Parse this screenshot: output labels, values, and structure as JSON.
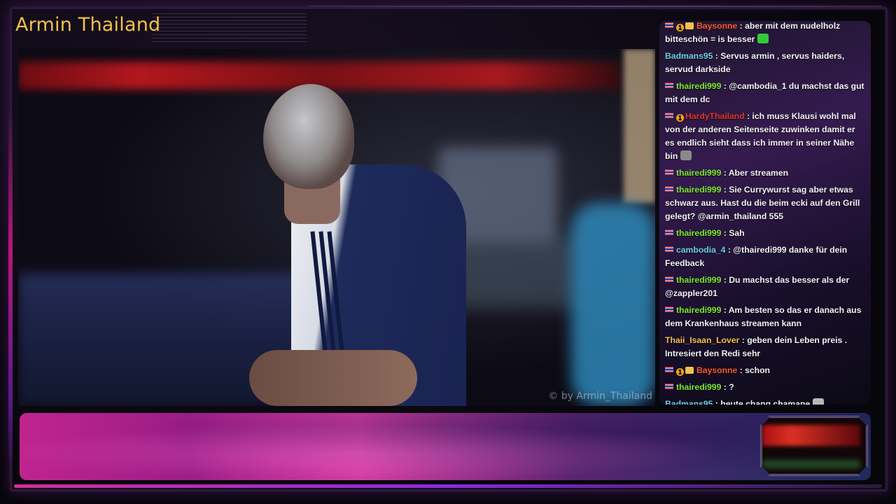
{
  "stream": {
    "title": "Armin Thailand",
    "watermark": "© by Armin_Thailand"
  },
  "colors": {
    "title": "#f2c04c",
    "chat_text": "#f2f2f4",
    "user_green": "#7bea2f",
    "user_cyan": "#6ecfe6",
    "user_red": "#e0332b",
    "user_orange": "#ff5a2a",
    "user_gold": "#f2c04c",
    "accent_magenta": "#c0248e"
  },
  "chat": {
    "messages": [
      {
        "user": "Baysonne",
        "color": "#ff5a2a",
        "flag": true,
        "badges": [
          "1",
          "crown"
        ],
        "text": "aber mit dem nudelholz bitteschön = is besser",
        "emote": "green-face"
      },
      {
        "user": "Badmans95",
        "color": "#6ecfe6",
        "flag": false,
        "badges": [],
        "text": "Servus armin , servus haiders, servud darkside",
        "emote": ""
      },
      {
        "user": "thairedi999",
        "color": "#7bea2f",
        "flag": true,
        "badges": [],
        "text": "@cambodia_1 du machst das gut mit dem dc",
        "emote": ""
      },
      {
        "user": "HardyThailand",
        "color": "#e0332b",
        "flag": true,
        "badges": [
          "1"
        ],
        "text": "ich muss Klausi wohl mal von der anderen Seitenseite zuwinken damit er es endlich sieht dass ich immer in seiner Nähe bin",
        "emote": "gray-face"
      },
      {
        "user": "thairedi999",
        "color": "#7bea2f",
        "flag": true,
        "badges": [],
        "text": "Aber streamen",
        "emote": ""
      },
      {
        "user": "thairedi999",
        "color": "#7bea2f",
        "flag": true,
        "badges": [],
        "text": "Sie Currywurst sag aber etwas schwarz aus. Hast du die beim ecki auf den Grill gelegt? @armin_thailand 555",
        "emote": ""
      },
      {
        "user": "thairedi999",
        "color": "#7bea2f",
        "flag": true,
        "badges": [],
        "text": "Sah",
        "emote": ""
      },
      {
        "user": "cambodia_4",
        "color": "#6ecfe6",
        "flag": true,
        "badges": [],
        "text": "@thairedi999 danke für dein Feedback",
        "emote": ""
      },
      {
        "user": "thairedi999",
        "color": "#7bea2f",
        "flag": true,
        "badges": [],
        "text": "Du machst das besser als der @zappler201",
        "emote": ""
      },
      {
        "user": "thairedi999",
        "color": "#7bea2f",
        "flag": true,
        "badges": [],
        "text": "Am besten so das er danach aus dem Krankenhaus streamen kann",
        "emote": ""
      },
      {
        "user": "Thaii_Isaan_Lover",
        "color": "#f2c04c",
        "flag": false,
        "badges": [],
        "text": "geben dein Leben preis . Intresiert den Redi sehr",
        "emote": ""
      },
      {
        "user": "Baysonne",
        "color": "#ff5a2a",
        "flag": true,
        "badges": [
          "1",
          "crown"
        ],
        "text": "schon",
        "emote": ""
      },
      {
        "user": "thairedi999",
        "color": "#7bea2f",
        "flag": true,
        "badges": [],
        "text": "?",
        "emote": ""
      },
      {
        "user": "Badmans95",
        "color": "#6ecfe6",
        "flag": false,
        "badges": [],
        "text": "heute chang chamane",
        "emote": "gray-hand"
      }
    ]
  }
}
